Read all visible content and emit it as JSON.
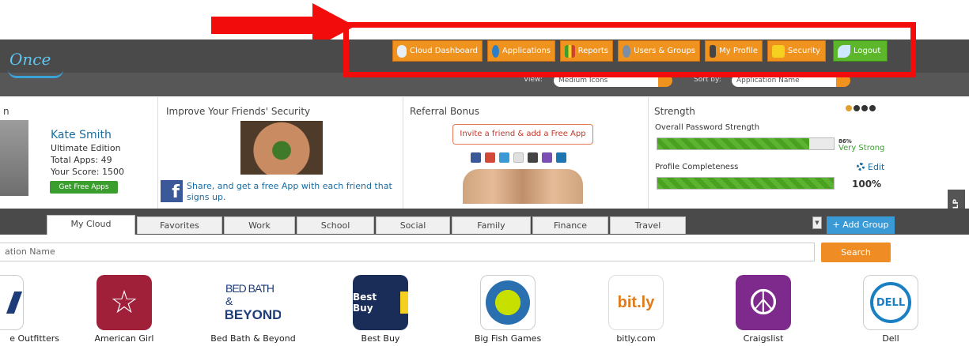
{
  "header": {
    "logo_text": "Once",
    "nav": [
      {
        "label": "Cloud Dashboard",
        "icon": "cloud-icon"
      },
      {
        "label": "Applications",
        "icon": "globe-icon"
      },
      {
        "label": "Reports",
        "icon": "chart-icon"
      },
      {
        "label": "Users & Groups",
        "icon": "users-icon"
      },
      {
        "label": "My Profile",
        "icon": "person-icon"
      },
      {
        "label": "Security",
        "icon": "lock-icon"
      },
      {
        "label": "Logout",
        "icon": "leaf-icon"
      }
    ],
    "view_label": "View:",
    "view_value": "Medium Icons",
    "sort_label": "Sort by:",
    "sort_value": "Application Name"
  },
  "panels": {
    "profile": {
      "title": "n",
      "name": "Kate Smith",
      "edition": "Ultimate Edition",
      "total_apps": "Total Apps: 49",
      "score": "Your Score: 1500",
      "button": "Get Free Apps"
    },
    "friends": {
      "title": "Improve Your Friends' Security",
      "share_text": "Share, and get a free App with each friend that signs up."
    },
    "referral": {
      "title": "Referral Bonus",
      "invite": "Invite a friend & add a Free App"
    },
    "strength": {
      "title": "Strength",
      "overall_label": "Overall Password Strength",
      "overall_percent": 86,
      "overall_percent_text": "86%",
      "overall_rating": "Very Strong",
      "profile_label": "Profile Completeness",
      "profile_percent": 100,
      "profile_percent_text": "100%",
      "edit": "Edit"
    }
  },
  "help": "HELP",
  "tabs": [
    "My Cloud",
    "Favorites",
    "Work",
    "School",
    "Social",
    "Family",
    "Finance",
    "Travel"
  ],
  "add_group": "+ Add Group",
  "search": {
    "placeholder": "ation Name",
    "button": "Search"
  },
  "apps": [
    {
      "name": "e Outfitters",
      "icon": "eagle-icon"
    },
    {
      "name": "American Girl",
      "icon": "american-girl-icon"
    },
    {
      "name": "Bed Bath & Beyond",
      "icon": "bed-bath-beyond-icon",
      "logo_top": "BED BATH &",
      "logo_bottom": "BEYOND"
    },
    {
      "name": "Best Buy",
      "icon": "best-buy-icon",
      "logo": "Best Buy"
    },
    {
      "name": "Big Fish Games",
      "icon": "big-fish-icon"
    },
    {
      "name": "bitly.com",
      "icon": "bitly-icon",
      "logo": "bit.ly"
    },
    {
      "name": "Craigslist",
      "icon": "peace-icon"
    },
    {
      "name": "Dell",
      "icon": "dell-icon",
      "logo": "DELL"
    }
  ],
  "colors": {
    "accent_orange": "#f0931e",
    "logout_green": "#5cb82a",
    "annotation_red": "#f20c0c",
    "link_blue": "#1a6ba0"
  }
}
